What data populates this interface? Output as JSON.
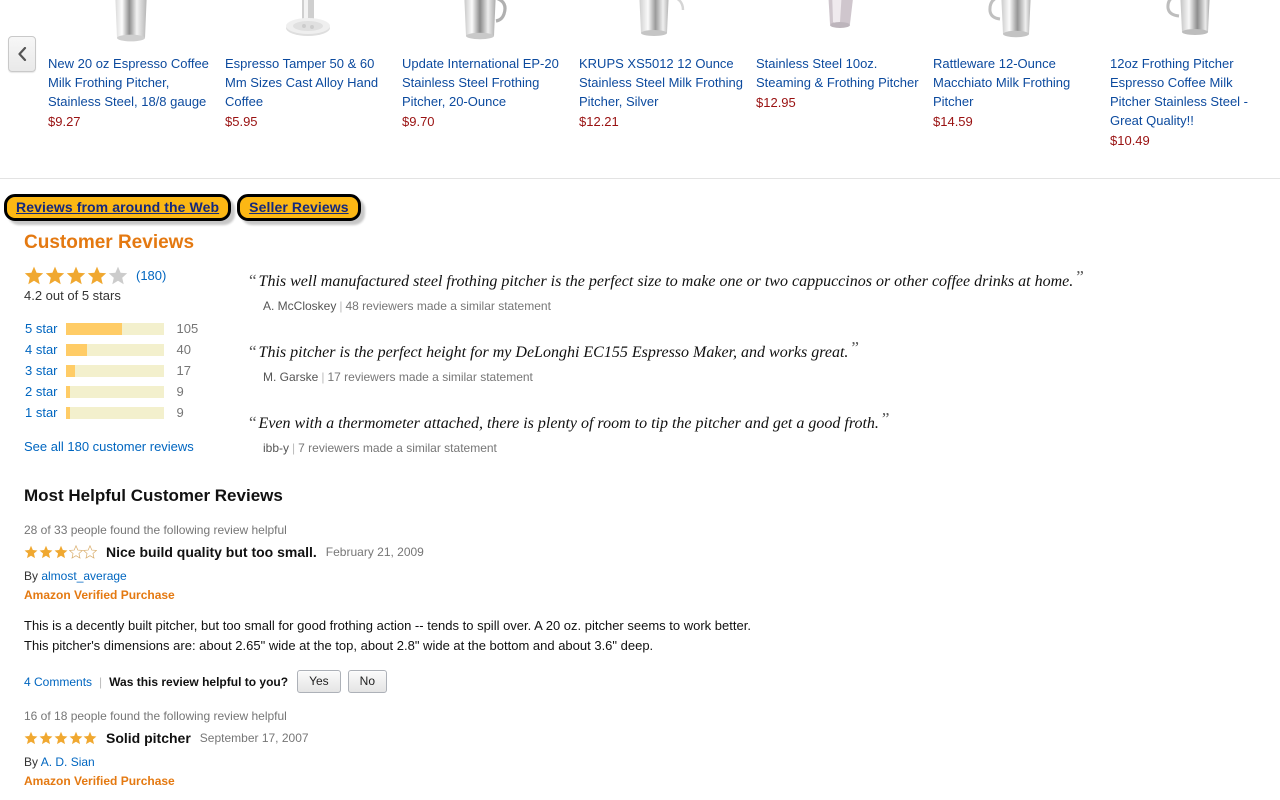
{
  "carousel": {
    "prev_button_icon": "chevron-left-icon",
    "products": [
      {
        "title": "New 20 oz Espresso Coffee Milk Frothing Pitcher, Stainless Steel, 18/8 gauge",
        "price": "$9.27",
        "image": "milk-frothing-pitcher-image"
      },
      {
        "title": "Espresso Tamper 50 & 60 Mm Sizes Cast Alloy Hand Coffee",
        "price": "$5.95",
        "image": "espresso-tamper-image"
      },
      {
        "title": "Update International EP-20 Stainless Steel Frothing Pitcher, 20-Ounce",
        "price": "$9.70",
        "image": "frothing-pitcher-image"
      },
      {
        "title": "KRUPS XS5012 12 Ounce Stainless Steel Milk Frothing Pitcher, Silver",
        "price": "$12.21",
        "image": "krups-pitcher-image"
      },
      {
        "title": "Stainless Steel 10oz. Steaming & Frothing Pitcher",
        "price": "$12.95",
        "image": "steaming-pitcher-image"
      },
      {
        "title": "Rattleware 12-Ounce Macchiato Milk Frothing Pitcher",
        "price": "$14.59",
        "image": "rattleware-pitcher-image"
      },
      {
        "title": "12oz Frothing Pitcher Espresso Coffee Milk Pitcher Stainless Steel - Great Quality!!",
        "price": "$10.49",
        "image": "frothing-pitcher-12oz-image"
      }
    ]
  },
  "chips": [
    {
      "label": "Reviews from around the Web"
    },
    {
      "label": "Seller Reviews"
    }
  ],
  "customer_reviews": {
    "heading": "Customer Reviews",
    "rating_value": 4.2,
    "rating_stars_filled": 4,
    "rating_stars_total": 5,
    "review_count_label": "(180)",
    "average_text": "4.2 out of 5 stars",
    "histogram": [
      {
        "label": "5 star",
        "percent": 58,
        "count": "105"
      },
      {
        "label": "4 star",
        "percent": 22,
        "count": "40"
      },
      {
        "label": "3 star",
        "percent": 10,
        "count": "17"
      },
      {
        "label": "2 star",
        "percent": 5,
        "count": "9"
      },
      {
        "label": "1 star",
        "percent": 5,
        "count": "9"
      }
    ],
    "see_all_label": "See all 180 customer reviews",
    "quote_open": "“",
    "quote_close": "”",
    "quotes": [
      {
        "text": "This well manufactured steel frothing pitcher is the perfect size to make one or two cappuccinos or other coffee drinks at home.",
        "author": "A. McCloskey",
        "similar": "48 reviewers made a similar statement"
      },
      {
        "text": "This pitcher is the perfect height for my DeLonghi EC155 Espresso Maker, and works great.",
        "author": "M. Garske",
        "similar": "17 reviewers made a similar statement"
      },
      {
        "text": "Even with a thermometer attached, there is plenty of room to tip the pitcher and get a good froth.",
        "author": "ibb-y",
        "similar": "7 reviewers made a similar statement"
      }
    ]
  },
  "most_helpful": {
    "heading": "Most Helpful Customer Reviews",
    "reviews": [
      {
        "helpful_line": "28 of 33 people found the following review helpful",
        "stars_filled": 3,
        "title": "Nice build quality but too small.",
        "date": "February 21, 2009",
        "by_prefix": "By ",
        "author": "almost_average",
        "verified": "Amazon Verified Purchase",
        "body_line_1": "This is a decently built pitcher, but too small for good frothing action -- tends to spill over. A 20 oz. pitcher seems to work better.",
        "body_line_2": "This pitcher's dimensions are: about 2.65\" wide at the top, about 2.8\" wide at the bottom and about 3.6\" deep.",
        "comments_label": "4 Comments",
        "helpful_question": "Was this review helpful to you?",
        "yes_label": "Yes",
        "no_label": "No"
      },
      {
        "helpful_line": "16 of 18 people found the following review helpful",
        "stars_filled": 5,
        "title": "Solid pitcher",
        "date": "September 17, 2007",
        "by_prefix": "By ",
        "author": "A. D. Sian",
        "verified": "Amazon Verified Purchase"
      }
    ]
  },
  "colors": {
    "link": "#0066c0",
    "price": "#991111",
    "heading_orange": "#e47911",
    "star_gold": "#f0a830",
    "star_empty": "#cccccc",
    "highlight_fill": "#fcb714",
    "highlight_text": "#14287d",
    "bar_fill": "#ffcc66",
    "bar_track": "#f3f0cd"
  }
}
